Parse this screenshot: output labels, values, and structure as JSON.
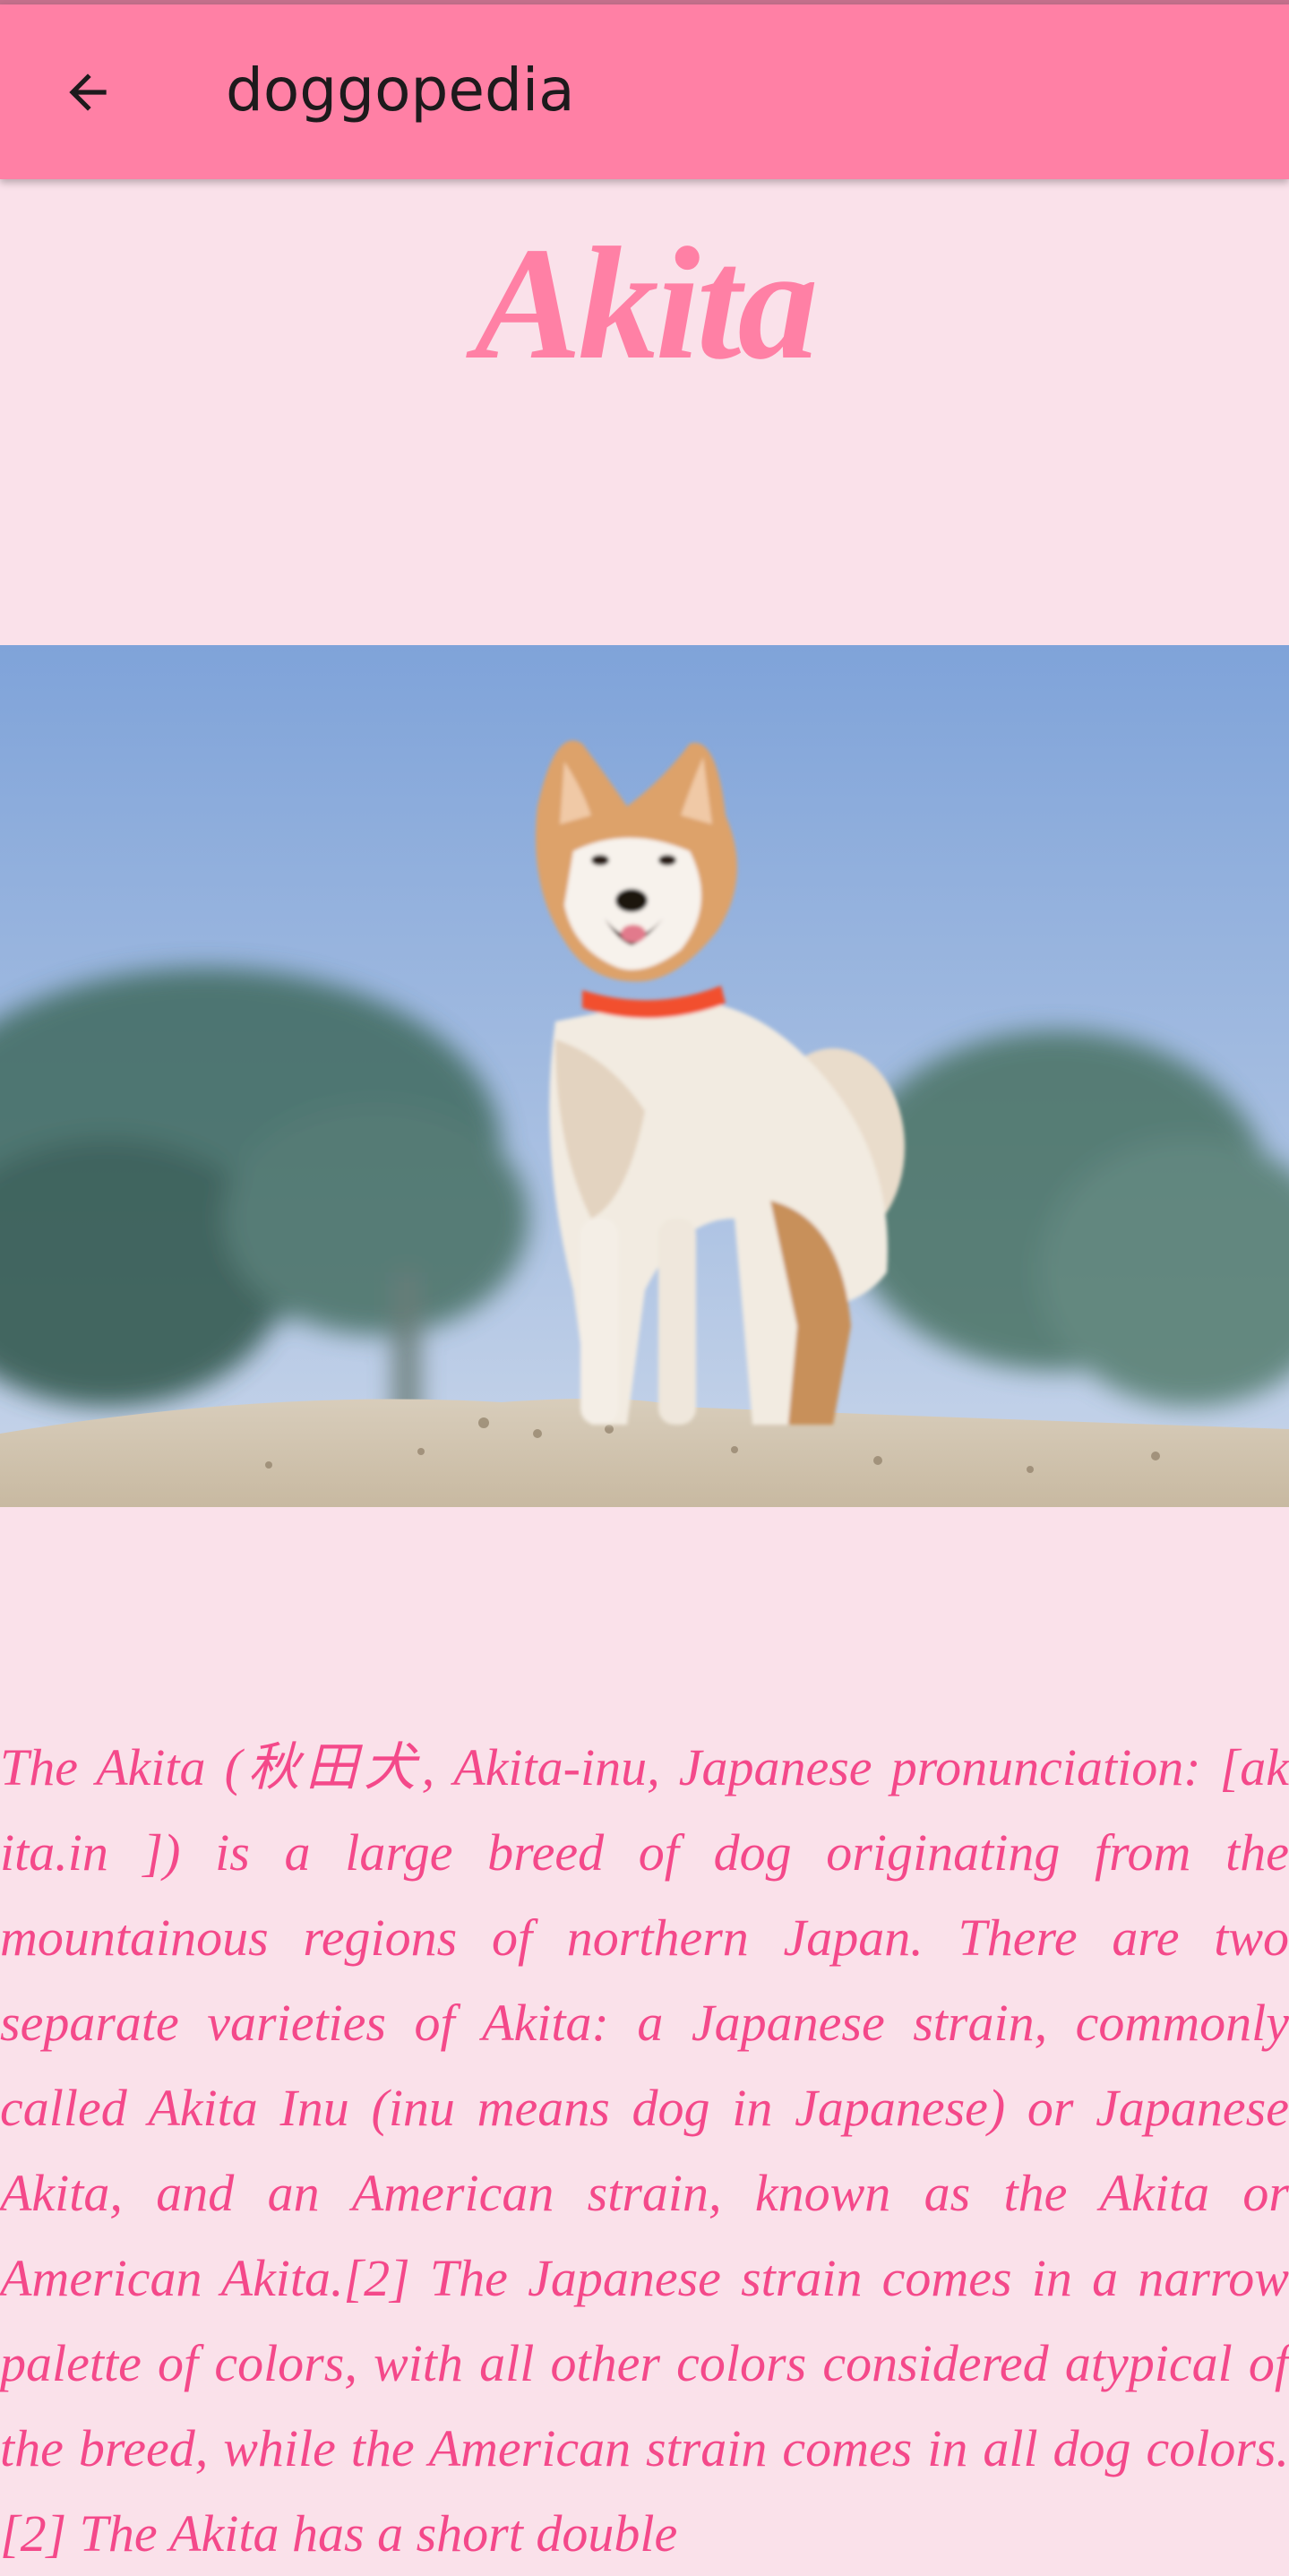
{
  "app_bar": {
    "title": "doggopedia",
    "back_icon": "arrow-back-icon",
    "background": "#FF80A5"
  },
  "breed": {
    "name": "Akita",
    "name_color": "#FF80A5",
    "photo_alt": "Akita dog standing on sand",
    "description": "The Akita (秋田犬, Akita-inu, Japanese pronunciation: [ak ita.in ]) is a large breed of dog originating from the mountainous regions of northern Japan. There are two separate varieties of Akita: a Japanese strain, commonly called Akita Inu (inu means dog in Japanese) or Japanese Akita, and an American strain, known as the Akita or American Akita.[2] The Japanese strain comes in a narrow palette of colors, with all other colors considered atypical of the breed, while the American strain comes in all dog colors.[2] The Akita has a short double",
    "description_color": "#F4498A"
  },
  "colors": {
    "page_background": "#FAE1EA"
  }
}
